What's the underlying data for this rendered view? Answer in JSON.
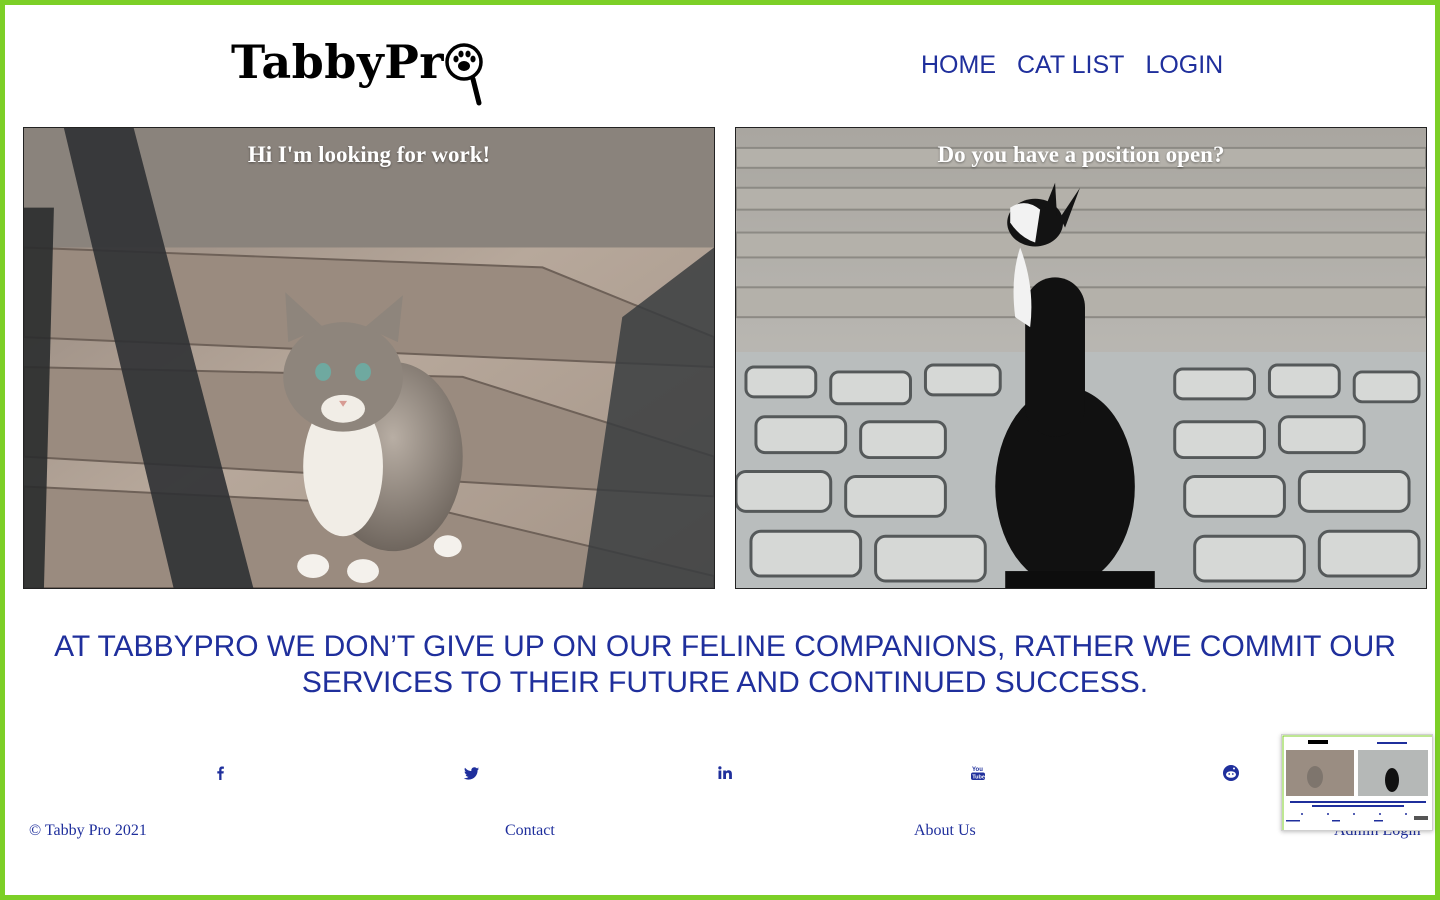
{
  "brand": {
    "name": "TabbyPr"
  },
  "nav": {
    "items": [
      "HOME",
      "CAT LIST",
      "LOGIN"
    ]
  },
  "hero": {
    "left_caption": "Hi I'm looking for work!",
    "right_caption": "Do you have a position open?"
  },
  "mission": "AT TABBYPRO WE DON’T GIVE UP ON OUR FELINE COMPANIONS, RATHER WE COMMIT OUR SERVICES TO THEIR FUTURE AND CONTINUED SUCCESS.",
  "social": [
    "facebook-icon",
    "twitter-icon",
    "linkedin-icon",
    "youtube-icon",
    "reddit-icon"
  ],
  "footer": {
    "copyright": "© Tabby Pro 2021",
    "contact": "Contact",
    "about": "About Us",
    "admin": "Admin Login"
  },
  "colors": {
    "border": "#7ccf27",
    "link": "#1f2f9c"
  }
}
